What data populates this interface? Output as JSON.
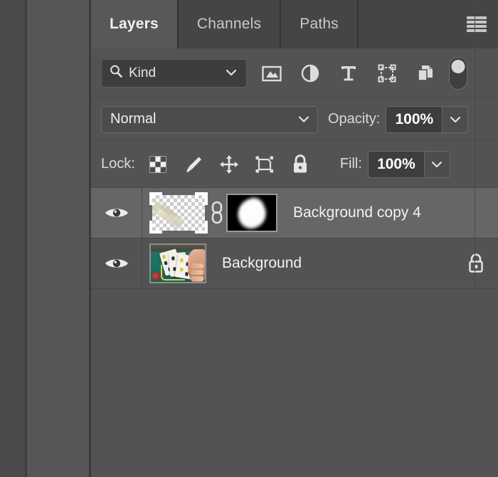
{
  "panel": {
    "tabs": [
      {
        "label": "Layers",
        "active": true
      },
      {
        "label": "Channels",
        "active": false
      },
      {
        "label": "Paths",
        "active": false
      }
    ],
    "menu_icon": "hamburger-menu-icon"
  },
  "filter_bar": {
    "search_icon": "search-icon",
    "kind_value": "Kind",
    "kind_chevron": "chevron-down-icon",
    "icons": [
      "pixel-layer-filter-icon",
      "adjustment-layer-filter-icon",
      "type-layer-filter-icon",
      "shape-layer-filter-icon",
      "smart-object-filter-icon"
    ],
    "toggle": "filter-enable-toggle"
  },
  "blend_bar": {
    "blend_mode": "Normal",
    "blend_chevron": "chevron-down-icon",
    "opacity_label": "Opacity:",
    "opacity_value": "100%",
    "opacity_chevron": "chevron-down-icon"
  },
  "lock_bar": {
    "lock_label": "Lock:",
    "icons": [
      "lock-transparent-pixels-icon",
      "lock-image-pixels-icon",
      "lock-position-icon",
      "lock-artboard-nesting-icon",
      "lock-all-icon"
    ],
    "fill_label": "Fill:",
    "fill_value": "100%",
    "fill_chevron": "chevron-down-icon"
  },
  "layers": [
    {
      "name": "Background copy 4",
      "selected": true,
      "visible": true,
      "visibility_icon": "eye-icon",
      "has_mask": true,
      "link_icon": "link-chain-icon",
      "thumbnail": "transparent-card-streak-thumbnail",
      "mask_thumbnail": "layer-mask-white-blob",
      "locked": false
    },
    {
      "name": "Background",
      "selected": false,
      "visible": true,
      "visibility_icon": "eye-icon",
      "has_mask": false,
      "thumbnail": "poker-table-cards-photo",
      "locked": true,
      "lock_icon": "lock-icon"
    }
  ],
  "colors": {
    "panel_bg": "#535353",
    "tabbar_bg": "#454545",
    "active_tab_bg": "#585858",
    "selected_row_bg": "#666666",
    "field_bg": "#3d3d3d",
    "text": "#f0f0f0",
    "icon": "#d8d8d8"
  }
}
